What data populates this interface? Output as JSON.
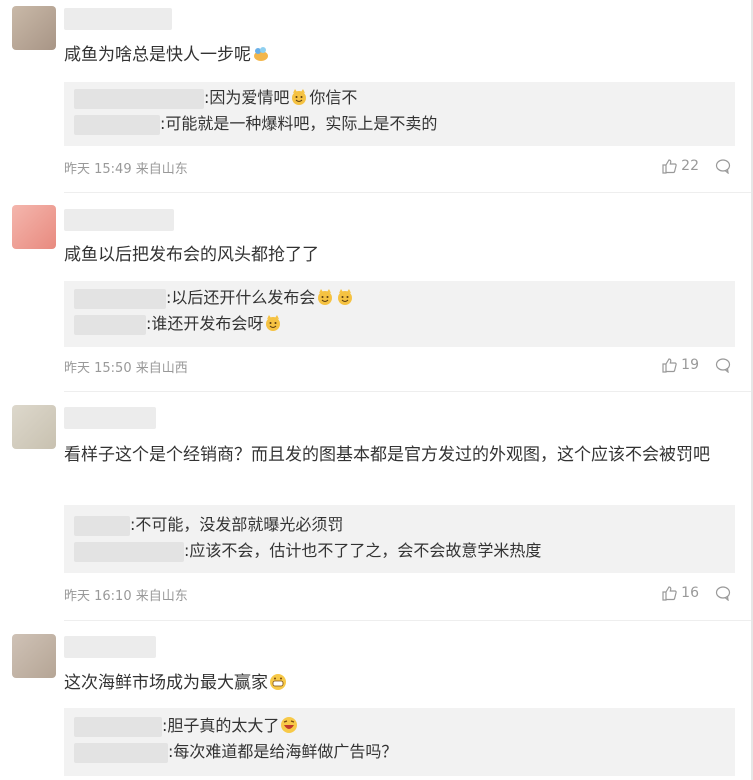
{
  "comments": [
    {
      "text": "咸鱼为啥总是快人一步呢",
      "emoji": "snack-emoji",
      "meta": "昨天 15:49 来自山东",
      "likes": "22",
      "replies": [
        {
          "text": ":因为爱情吧",
          "emoji_after": "cat-face-emoji",
          "text2": "你信不"
        },
        {
          "text": ":可能就是一种爆料吧，实际上是不卖的"
        }
      ]
    },
    {
      "text": "咸鱼以后把发布会的风头都抢了了",
      "meta": "昨天 15:50 来自山西",
      "likes": "19",
      "replies": [
        {
          "text": ":以后还开什么发布会"
        },
        {
          "text": ":谁还开发布会呀"
        }
      ]
    },
    {
      "text": "看样子这个是个经销商？而且发的图基本都是官方发过的外观图，这个应该不会被罚吧",
      "meta": "昨天 16:10 来自山东",
      "likes": "16",
      "replies": [
        {
          "text": ":不可能，没发部就曝光必须罚"
        },
        {
          "text": ":应该不会，估计也不了了之，会不会故意学米热度"
        }
      ]
    },
    {
      "text": "这次海鲜市场成为最大赢家",
      "replies": [
        {
          "text": ":胆子真的太大了"
        },
        {
          "text": ":每次难道都是给海鲜做广告吗？"
        }
      ]
    }
  ],
  "colors": {
    "meta_text": "#999999",
    "reply_bg": "#f2f2f2",
    "divider": "#eeeeee"
  }
}
